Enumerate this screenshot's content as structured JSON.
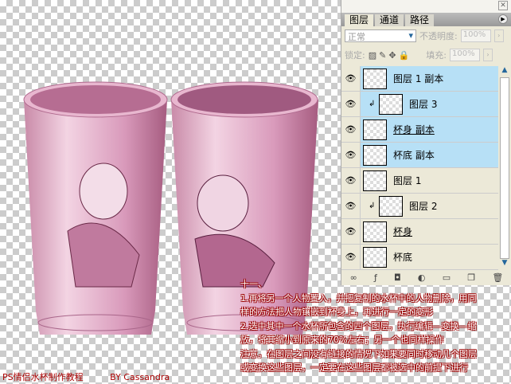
{
  "panel": {
    "tabs": [
      "图层",
      "通道",
      "路径"
    ],
    "blend_mode": "正常",
    "opacity_label": "不透明度:",
    "opacity": "100%",
    "lock_label": "锁定:",
    "fill_label": "填充:",
    "fill": "100%",
    "layers": [
      {
        "name": "图层 1 副本",
        "selected": true,
        "clipped": false,
        "underline": false
      },
      {
        "name": "图层 3",
        "selected": true,
        "clipped": true,
        "underline": false
      },
      {
        "name": "杯身 副本",
        "selected": true,
        "clipped": false,
        "underline": true
      },
      {
        "name": "杯底 副本",
        "selected": true,
        "clipped": false,
        "underline": false
      },
      {
        "name": "图层 1",
        "selected": false,
        "clipped": false,
        "underline": false
      },
      {
        "name": "图层 2",
        "selected": false,
        "clipped": true,
        "underline": false
      },
      {
        "name": "杯身",
        "selected": false,
        "clipped": false,
        "underline": true
      },
      {
        "name": "杯底",
        "selected": false,
        "clipped": false,
        "underline": false
      }
    ]
  },
  "instructions": {
    "heading": "十一、",
    "lines": [
      "1.再将另一个人物置入，并把复制的水杯中的人物删除，用同",
      "样的方法把人物镶嵌到杯身上，再进行一定的变形",
      "2.选中其中一个水杯所包含的四个图层，执行编辑—变换—缩",
      "放，将其缩小到原来的70%左右；另一个也同样操作",
      "注意，在图层之间没有链接的情况下如果要同时移动几个图层",
      "或变换这些图层，一定要在这些图层都被选中的前提下进行"
    ]
  },
  "footer": {
    "title": "PS情侣水杯制作教程",
    "author": "BY Cassandra"
  }
}
